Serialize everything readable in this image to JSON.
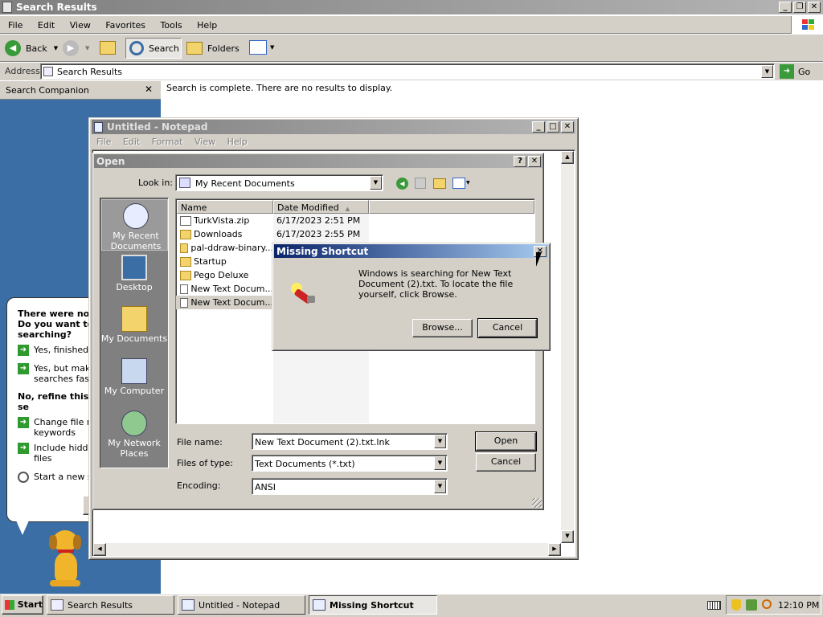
{
  "search_window": {
    "title": "Search Results",
    "menu": [
      "File",
      "Edit",
      "View",
      "Favorites",
      "Tools",
      "Help"
    ],
    "toolbar": {
      "back": "Back",
      "search": "Search",
      "folders": "Folders"
    },
    "address_label": "Address",
    "address_value": "Search Results",
    "go_label": "Go",
    "companion_title": "Search Companion",
    "status_message": "Search is complete. There are no results to display.",
    "companion": {
      "question": "There were no f\nDo you want to\nsearching?",
      "opt1": "Yes, finished s",
      "opt2": "Yes, but make\nsearches faste",
      "refine": "No, refine this se",
      "opt3": "Change file na\nkeywords",
      "opt4": "Include hidden\nfiles",
      "opt5": "Start a new se"
    }
  },
  "notepad": {
    "title": "Untitled - Notepad",
    "menu": [
      "File",
      "Edit",
      "Format",
      "View",
      "Help"
    ]
  },
  "open_dialog": {
    "title": "Open",
    "look_in_label": "Look in:",
    "look_in_value": "My Recent Documents",
    "columns": {
      "name": "Name",
      "date": "Date Modified"
    },
    "files": [
      {
        "name": "TurkVista.zip",
        "date": "6/17/2023 2:51 PM",
        "type": "doc"
      },
      {
        "name": "Downloads",
        "date": "6/17/2023 2:55 PM",
        "type": "folder"
      },
      {
        "name": "pal-ddraw-binary...",
        "date": "",
        "type": "folder"
      },
      {
        "name": "Startup",
        "date": "",
        "type": "folder"
      },
      {
        "name": "Pego Deluxe",
        "date": "",
        "type": "folder"
      },
      {
        "name": "New Text Docum...",
        "date": "",
        "type": "doc"
      },
      {
        "name": "New Text Docum...",
        "date": "",
        "type": "doc"
      }
    ],
    "places": [
      "My Recent\nDocuments",
      "Desktop",
      "My Documents",
      "My Computer",
      "My Network\nPlaces"
    ],
    "file_name_label": "File name:",
    "file_name_value": "New Text Document (2).txt.lnk",
    "file_type_label": "Files of type:",
    "file_type_value": "Text Documents (*.txt)",
    "encoding_label": "Encoding:",
    "encoding_value": "ANSI",
    "open_button": "Open",
    "cancel_button": "Cancel"
  },
  "missing_shortcut": {
    "title": "Missing Shortcut",
    "message": "Windows is searching for New Text Document (2).txt. To locate the file yourself, click Browse.",
    "browse_button": "Browse...",
    "cancel_button": "Cancel"
  },
  "taskbar": {
    "start": "Start",
    "tasks": [
      "Search Results",
      "Untitled - Notepad",
      "Missing Shortcut"
    ],
    "clock": "12:10 PM"
  },
  "colors": {
    "active_title": "#0a246a",
    "inactive_title": "#7f7f7f",
    "desktop_blue": "#3a6ea5",
    "face": "#d4d0c8"
  }
}
